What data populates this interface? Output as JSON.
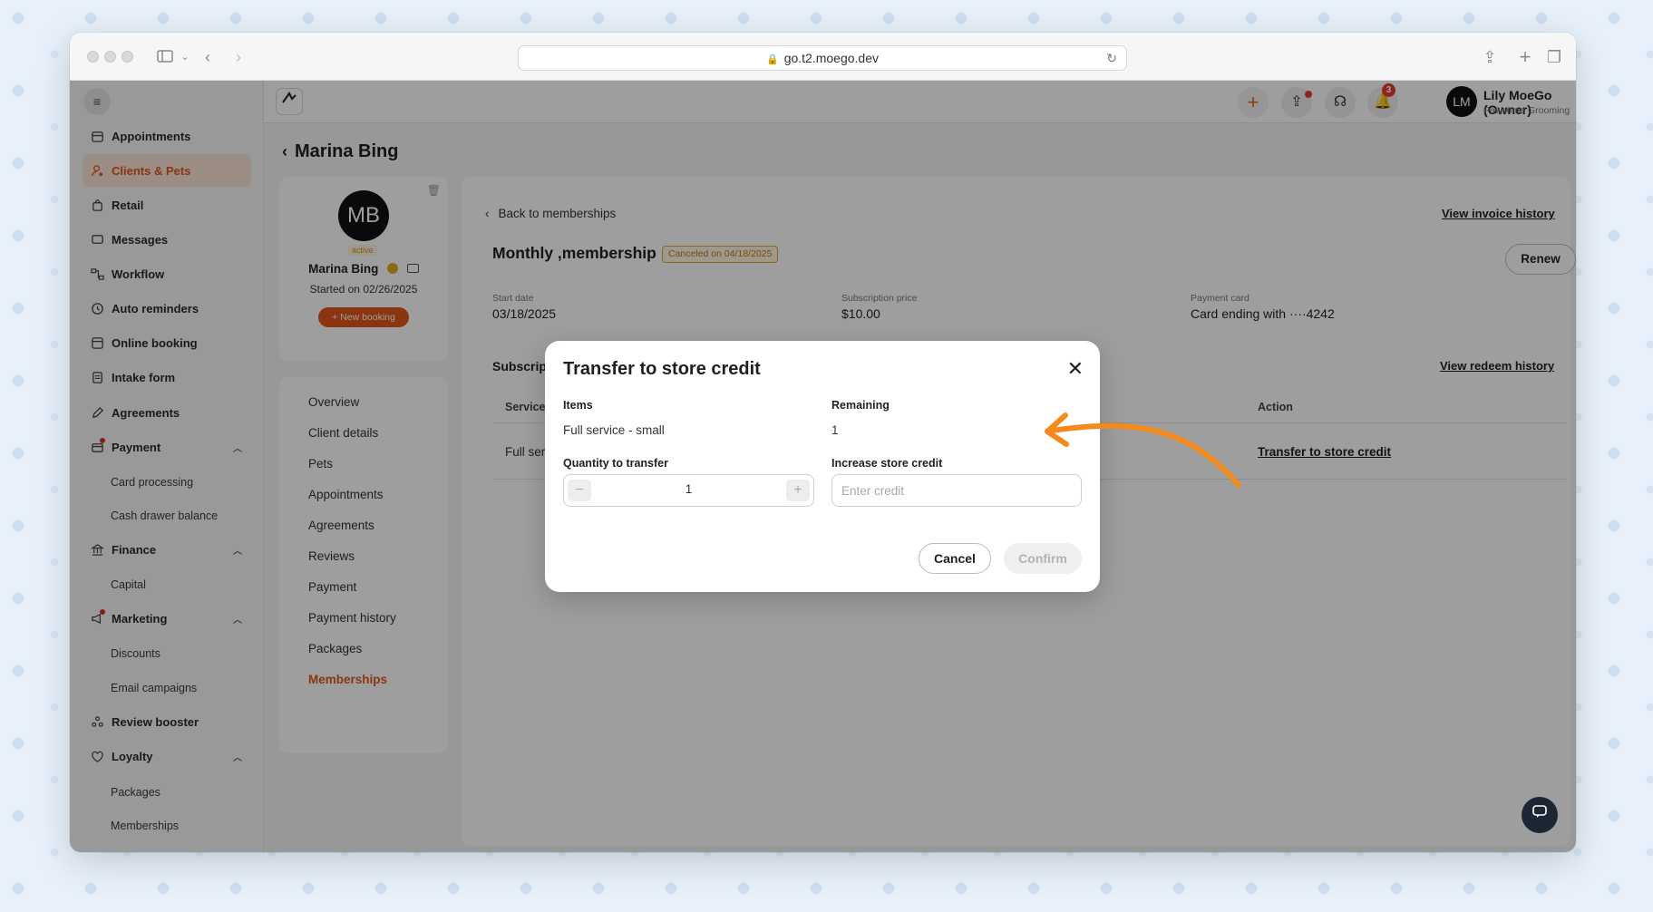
{
  "browser": {
    "url": "go.t2.moego.dev"
  },
  "sidebar": {
    "items": [
      {
        "label": "Appointments",
        "icon": "calendar-icon"
      },
      {
        "label": "Clients & Pets",
        "icon": "paw-user-icon",
        "active": true
      },
      {
        "label": "Retail",
        "icon": "bag-icon"
      },
      {
        "label": "Messages",
        "icon": "chat-icon"
      },
      {
        "label": "Workflow",
        "icon": "workflow-icon"
      },
      {
        "label": "Auto reminders",
        "icon": "clock-icon"
      },
      {
        "label": "Online booking",
        "icon": "browser-icon"
      },
      {
        "label": "Intake form",
        "icon": "form-icon"
      },
      {
        "label": "Agreements",
        "icon": "pen-icon"
      },
      {
        "label": "Payment",
        "icon": "payment-icon"
      },
      {
        "label": "Finance",
        "icon": "bank-icon"
      },
      {
        "label": "Marketing",
        "icon": "megaphone-icon"
      },
      {
        "label": "Review booster",
        "icon": "review-icon"
      },
      {
        "label": "Loyalty",
        "icon": "heart-icon"
      }
    ],
    "subitems": {
      "payment": [
        "Card processing",
        "Cash drawer balance"
      ],
      "finance": [
        "Capital"
      ],
      "marketing": [
        "Discounts",
        "Email campaigns"
      ],
      "loyalty": [
        "Packages",
        "Memberships"
      ]
    }
  },
  "topbar": {
    "notification_count": "3",
    "user_initials": "LM",
    "user_name": "Lily MoeGo (Owner)",
    "business_name": "Pawsome Grooming"
  },
  "page": {
    "title": "Marina Bing"
  },
  "profile": {
    "initials": "MB",
    "status": "active",
    "name": "Marina Bing",
    "started": "Started on 02/26/2025",
    "new_booking": "+ New booking"
  },
  "client_nav": [
    "Overview",
    "Client details",
    "Pets",
    "Appointments",
    "Agreements",
    "Reviews",
    "Payment",
    "Payment history",
    "Packages",
    "Memberships"
  ],
  "membership": {
    "back_label": "Back to memberships",
    "invoice_history": "View invoice history",
    "title": "Monthly ,membership",
    "canceled_badge": "Canceled on 04/18/2025",
    "renew": "Renew",
    "start_date_label": "Start date",
    "start_date": "03/18/2025",
    "price_label": "Subscription price",
    "price": "$10.00",
    "card_label": "Payment card",
    "card": "Card ending with ····4242",
    "section_title": "Subscrip",
    "redeem_history": "View redeem history",
    "col_service": "Service",
    "col_action": "Action",
    "row_service": "Full ser",
    "row_action": "Transfer to store credit"
  },
  "modal": {
    "title": "Transfer to store credit",
    "items_label": "Items",
    "items_value": "Full service - small",
    "remaining_label": "Remaining",
    "remaining_value": "1",
    "quantity_label": "Quantity to transfer",
    "quantity_value": "1",
    "credit_label": "Increase store credit",
    "credit_placeholder": "Enter credit",
    "cancel": "Cancel",
    "confirm": "Confirm"
  },
  "colors": {
    "brand": "#e0561b",
    "annotation_arrow": "#f28a1c"
  }
}
